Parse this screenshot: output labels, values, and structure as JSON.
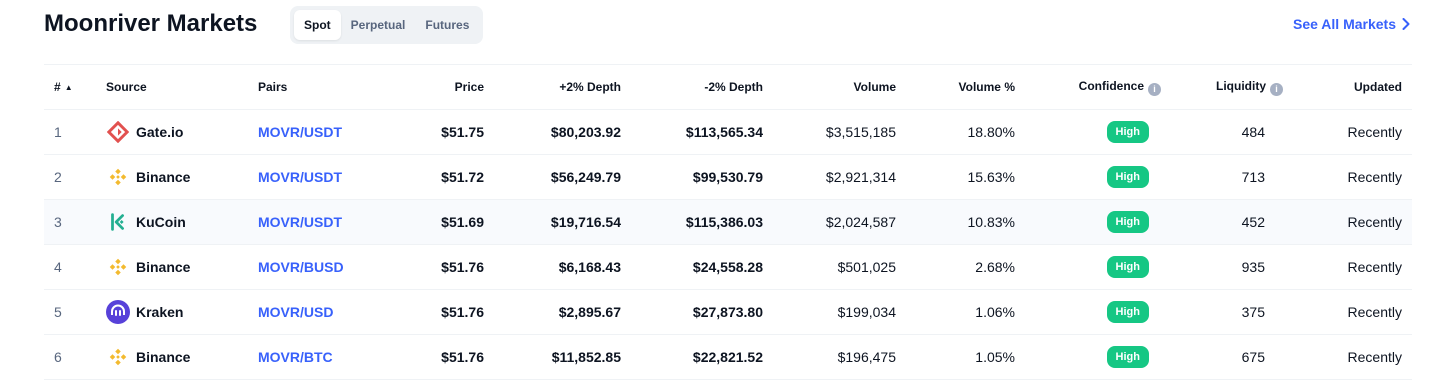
{
  "header": {
    "title": "Moonriver Markets",
    "tabs": [
      "Spot",
      "Perpetual",
      "Futures"
    ],
    "active_tab": "Spot",
    "see_all": "See All Markets"
  },
  "table": {
    "columns": {
      "rank": "#",
      "source": "Source",
      "pairs": "Pairs",
      "price": "Price",
      "depth_plus": "+2% Depth",
      "depth_minus": "-2% Depth",
      "volume": "Volume",
      "volume_pct": "Volume %",
      "confidence": "Confidence",
      "liquidity": "Liquidity",
      "updated": "Updated"
    },
    "rows": [
      {
        "rank": "1",
        "source": "Gate.io",
        "logo": "gateio-logo",
        "pair": "MOVR/USDT",
        "price": "$51.75",
        "depth_plus": "$80,203.92",
        "depth_minus": "$113,565.34",
        "volume": "$3,515,185",
        "volume_pct": "18.80%",
        "confidence": "High",
        "liquidity": "484",
        "updated": "Recently"
      },
      {
        "rank": "2",
        "source": "Binance",
        "logo": "binance-logo",
        "pair": "MOVR/USDT",
        "price": "$51.72",
        "depth_plus": "$56,249.79",
        "depth_minus": "$99,530.79",
        "volume": "$2,921,314",
        "volume_pct": "15.63%",
        "confidence": "High",
        "liquidity": "713",
        "updated": "Recently"
      },
      {
        "rank": "3",
        "source": "KuCoin",
        "logo": "kucoin-logo",
        "pair": "MOVR/USDT",
        "price": "$51.69",
        "depth_plus": "$19,716.54",
        "depth_minus": "$115,386.03",
        "volume": "$2,024,587",
        "volume_pct": "10.83%",
        "confidence": "High",
        "liquidity": "452",
        "updated": "Recently"
      },
      {
        "rank": "4",
        "source": "Binance",
        "logo": "binance-logo",
        "pair": "MOVR/BUSD",
        "price": "$51.76",
        "depth_plus": "$6,168.43",
        "depth_minus": "$24,558.28",
        "volume": "$501,025",
        "volume_pct": "2.68%",
        "confidence": "High",
        "liquidity": "935",
        "updated": "Recently"
      },
      {
        "rank": "5",
        "source": "Kraken",
        "logo": "kraken-logo",
        "pair": "MOVR/USD",
        "price": "$51.76",
        "depth_plus": "$2,895.67",
        "depth_minus": "$27,873.80",
        "volume": "$199,034",
        "volume_pct": "1.06%",
        "confidence": "High",
        "liquidity": "375",
        "updated": "Recently"
      },
      {
        "rank": "6",
        "source": "Binance",
        "logo": "binance-logo",
        "pair": "MOVR/BTC",
        "price": "$51.76",
        "depth_plus": "$11,852.85",
        "depth_minus": "$22,821.52",
        "volume": "$196,475",
        "volume_pct": "1.05%",
        "confidence": "High",
        "liquidity": "675",
        "updated": "Recently"
      }
    ]
  },
  "colors": {
    "accent": "#3861fb",
    "confidence_high": "#16c784",
    "text_primary": "#0d1421",
    "text_secondary": "#58667e"
  }
}
